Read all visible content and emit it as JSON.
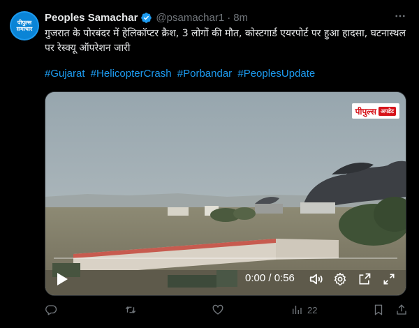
{
  "author": {
    "name": "Peoples Samachar",
    "handle": "@psamachar1",
    "separator": "·",
    "time": "8m",
    "avatar_text_line1": "पीपुल्स",
    "avatar_text_line2": "समाचार"
  },
  "tweet": {
    "text": "गुजरात के पोरबंदर में हेलिकॉप्टर क्रैश, 3 लोगों की मौत, कोस्टगार्ड एयरपोर्ट पर हुआ हादसा, घटनास्थल पर रेस्क्यू ऑपरेशन जारी",
    "hashtags": [
      "#Gujarat",
      "#HelicopterCrash",
      "#Porbandar",
      "#PeoplesUpdate"
    ]
  },
  "video": {
    "watermark_main": "पीपुल्स",
    "watermark_sub": "अपडेट",
    "time_display": "0:00 / 0:56",
    "progress_fraction": 0.0
  },
  "actions": {
    "reply_count": "",
    "retweet_count": "",
    "like_count": "",
    "views_count": "22"
  },
  "colors": {
    "accent": "#1d9bf0",
    "muted": "#71767b",
    "background": "#000000",
    "text": "#e7e9ea"
  },
  "icons": [
    "verified-badge-icon",
    "more-icon",
    "play-icon",
    "volume-icon",
    "settings-icon",
    "popout-icon",
    "fullscreen-icon",
    "reply-icon",
    "retweet-icon",
    "like-icon",
    "views-icon",
    "bookmark-icon",
    "share-icon"
  ]
}
